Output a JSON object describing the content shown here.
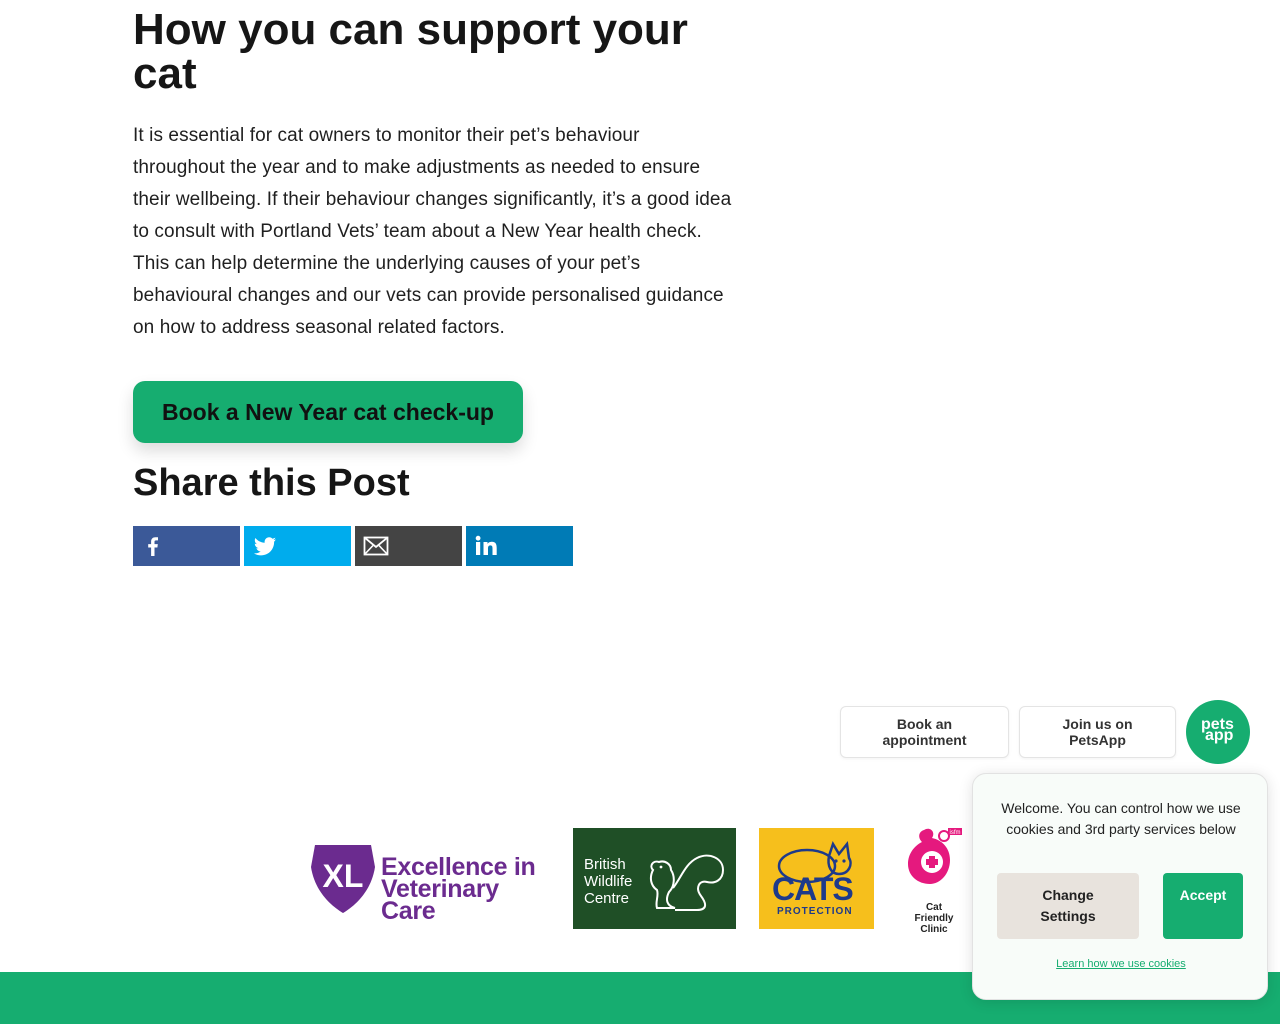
{
  "article": {
    "heading": "How you can support your cat",
    "body": "It is essential for cat owners to monitor their pet’s behaviour throughout the year and to make adjustments as needed to ensure their wellbeing. If their behaviour changes significantly, it’s a good idea to consult with Portland Vets’ team about a New Year health check. This can help determine the underlying causes of your pet’s behavioural changes and our vets can provide personalised guidance on how to address seasonal related factors.",
    "cta_label": "Book a New Year cat check-up"
  },
  "share": {
    "title": "Share this Post",
    "buttons": [
      {
        "icon": "facebook-icon",
        "color": "#3b5998"
      },
      {
        "icon": "twitter-icon",
        "color": "#00aced"
      },
      {
        "icon": "email-icon",
        "color": "#444444"
      },
      {
        "icon": "linkedin-icon",
        "color": "#007bb6"
      }
    ]
  },
  "floating": {
    "book_label": "Book an appointment",
    "join_label": "Join us on PetsApp",
    "petsapp_line1": "pets",
    "petsapp_line2": "app"
  },
  "logos": {
    "xl_mark": "XL",
    "xl_text_line1": "Excellence in",
    "xl_text_line2": "Veterinary Care",
    "bwc_line1": "British",
    "bwc_line2": "Wildlife",
    "bwc_line3": "Centre",
    "cats_word": "CATS",
    "cats_sub": "PROTECTION",
    "cfc_line1": "Cat",
    "cfc_line2": "Friendly",
    "cfc_line3": "Clinic",
    "cfc_tag": "isfm"
  },
  "cookie": {
    "message": "Welcome. You can control how we use cookies and 3rd party services below",
    "change_label": "Change Settings",
    "accept_label": "Accept",
    "learn_link": "Learn how we use cookies"
  },
  "colors": {
    "brand_green": "#16ad70",
    "xl_purple": "#6b2b8f",
    "bwc_green": "#1f4f26",
    "cats_yellow": "#f6bf1c",
    "cfc_pink": "#e5197e"
  }
}
